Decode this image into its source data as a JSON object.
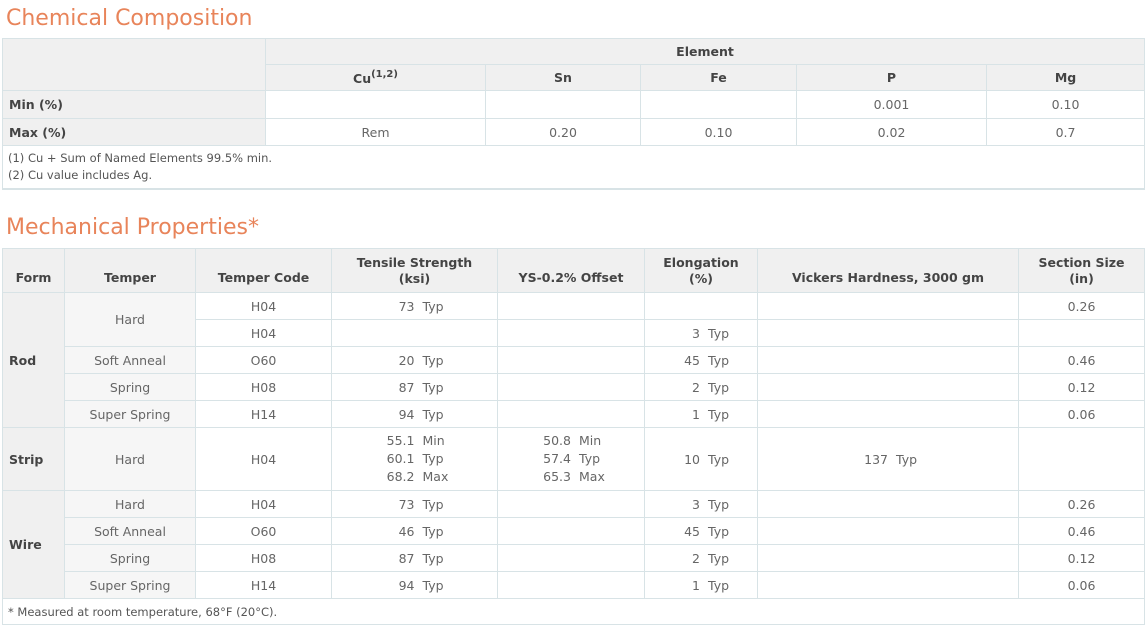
{
  "chemical": {
    "title": "Chemical Composition",
    "group_header": "Element",
    "columns": [
      {
        "label": "Cu",
        "sup": "(1,2)"
      },
      {
        "label": "Sn",
        "sup": ""
      },
      {
        "label": "Fe",
        "sup": ""
      },
      {
        "label": "P",
        "sup": ""
      },
      {
        "label": "Mg",
        "sup": ""
      }
    ],
    "rows": [
      {
        "label": "Min (%)",
        "values": [
          "",
          "",
          "",
          "0.001",
          "0.10"
        ]
      },
      {
        "label": "Max (%)",
        "values": [
          "Rem",
          "0.20",
          "0.10",
          "0.02",
          "0.7"
        ]
      }
    ],
    "notes": [
      "(1) Cu + Sum of Named Elements 99.5% min.",
      "(2) Cu value includes Ag."
    ]
  },
  "mechanical": {
    "title": "Mechanical Properties*",
    "headers": {
      "form": "Form",
      "temper": "Temper",
      "temper_code": "Temper Code",
      "tensile_line1": "Tensile Strength",
      "tensile_line2": "(ksi)",
      "ys": "YS-0.2% Offset",
      "elong_line1": "Elongation",
      "elong_line2": "(%)",
      "vickers": "Vickers Hardness, 3000 gm",
      "section_line1": "Section Size",
      "section_line2": "(in)"
    },
    "forms": {
      "rod": "Rod",
      "strip": "Strip",
      "wire": "Wire"
    },
    "rows": [
      {
        "temper": "Hard",
        "code": "H04",
        "tensile": [
          "73",
          "Typ"
        ],
        "ys": [
          "",
          ""
        ],
        "elong": [
          "",
          ""
        ],
        "section": "0.26"
      },
      {
        "temper": "",
        "code": "H04",
        "tensile": [
          "",
          ""
        ],
        "ys": [
          "",
          ""
        ],
        "elong": [
          "3",
          "Typ"
        ],
        "section": ""
      },
      {
        "temper": "Soft Anneal",
        "code": "O60",
        "tensile": [
          "20",
          "Typ"
        ],
        "ys": [
          "",
          ""
        ],
        "elong": [
          "45",
          "Typ"
        ],
        "section": "0.46"
      },
      {
        "temper": "Spring",
        "code": "H08",
        "tensile": [
          "87",
          "Typ"
        ],
        "ys": [
          "",
          ""
        ],
        "elong": [
          "2",
          "Typ"
        ],
        "section": "0.12"
      },
      {
        "temper": "Super Spring",
        "code": "H14",
        "tensile": [
          "94",
          "Typ"
        ],
        "ys": [
          "",
          ""
        ],
        "elong": [
          "1",
          "Typ"
        ],
        "section": "0.06"
      }
    ],
    "strip": {
      "temper": "Hard",
      "code": "H04",
      "tensile": [
        [
          "55.1",
          "Min"
        ],
        [
          "60.1",
          "Typ"
        ],
        [
          "68.2",
          "Max"
        ]
      ],
      "ys": [
        [
          "50.8",
          "Min"
        ],
        [
          "57.4",
          "Typ"
        ],
        [
          "65.3",
          "Max"
        ]
      ],
      "elong": [
        "10",
        "Typ"
      ],
      "vickers": [
        "137",
        "Typ"
      ]
    },
    "wire": [
      {
        "temper": "Hard",
        "code": "H04",
        "tensile": [
          "73",
          "Typ"
        ],
        "elong": [
          "3",
          "Typ"
        ],
        "section": "0.26"
      },
      {
        "temper": "Soft Anneal",
        "code": "O60",
        "tensile": [
          "46",
          "Typ"
        ],
        "elong": [
          "45",
          "Typ"
        ],
        "section": "0.46"
      },
      {
        "temper": "Spring",
        "code": "H08",
        "tensile": [
          "87",
          "Typ"
        ],
        "elong": [
          "2",
          "Typ"
        ],
        "section": "0.12"
      },
      {
        "temper": "Super Spring",
        "code": "H14",
        "tensile": [
          "94",
          "Typ"
        ],
        "elong": [
          "1",
          "Typ"
        ],
        "section": "0.06"
      }
    ],
    "footnote": "* Measured at room temperature, 68°F (20°C)."
  }
}
